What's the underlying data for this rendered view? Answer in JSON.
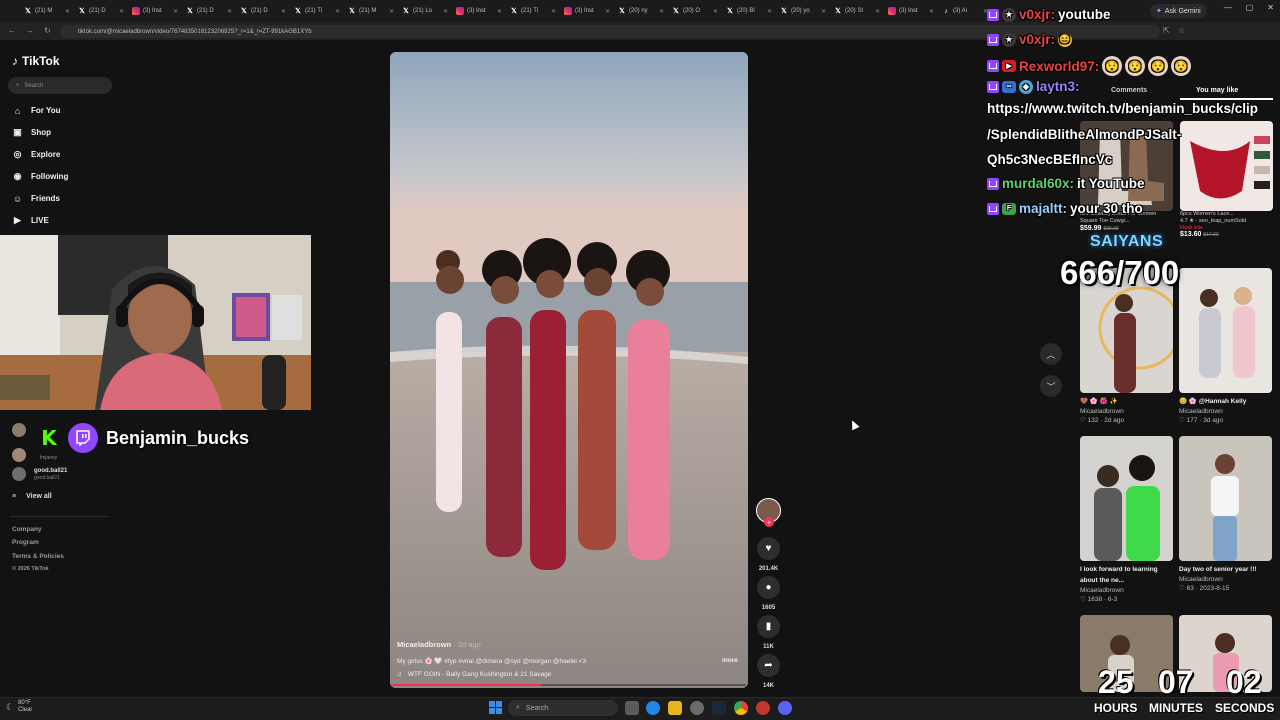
{
  "browser": {
    "tabs": [
      {
        "icon": "x-logo-icon",
        "label": "(21) M"
      },
      {
        "icon": "x-logo-icon",
        "label": "(21) D"
      },
      {
        "icon": "instagram-icon",
        "label": "(3) Inst"
      },
      {
        "icon": "x-logo-icon",
        "label": "(21) D"
      },
      {
        "icon": "x-logo-icon",
        "label": "(21) D"
      },
      {
        "icon": "x-logo-icon",
        "label": "(21) Ti"
      },
      {
        "icon": "x-logo-icon",
        "label": "(21) M"
      },
      {
        "icon": "x-logo-icon",
        "label": "(21) Lo"
      },
      {
        "icon": "instagram-icon",
        "label": "(3) Inst"
      },
      {
        "icon": "x-logo-icon",
        "label": "(21) Ti"
      },
      {
        "icon": "instagram-icon",
        "label": "(3) Inst"
      },
      {
        "icon": "x-logo-icon",
        "label": "(20) ny"
      },
      {
        "icon": "x-logo-icon",
        "label": "(20) O"
      },
      {
        "icon": "x-logo-icon",
        "label": "(20) Bi"
      },
      {
        "icon": "x-logo-icon",
        "label": "(20) yo"
      },
      {
        "icon": "x-logo-icon",
        "label": "(20) St"
      },
      {
        "icon": "instagram-icon",
        "label": "(3) Inst"
      },
      {
        "icon": "tiktok-icon",
        "label": "(3) Ai"
      }
    ],
    "gemini_label": "Ask Gemini",
    "url": "tiktok.com/@micaeladbrown/video/7674835016123206925?_r=1&_t=ZT-991kAGB1XYb"
  },
  "tiktok": {
    "logo_text": "TikTok",
    "search_placeholder": "Search",
    "nav": [
      {
        "icon": "home-icon",
        "label": "For You"
      },
      {
        "icon": "shop-bag-icon",
        "label": "Shop"
      },
      {
        "icon": "compass-icon",
        "label": "Explore"
      },
      {
        "icon": "following-icon",
        "label": "Following"
      },
      {
        "icon": "friends-icon",
        "label": "Friends"
      },
      {
        "icon": "live-icon",
        "label": "LIVE"
      }
    ],
    "following_accounts": [
      {
        "name": "",
        "handle": "lmjaney"
      },
      {
        "name": "good.ball21",
        "handle": "good.ball21"
      }
    ],
    "view_all": "View all",
    "footer": [
      "Company",
      "Program",
      "Terms & Policies",
      "© 2026 TikTok"
    ]
  },
  "stream": {
    "streamer_name": "Benjamin_bucks",
    "saiyans_label": "SAIYANS",
    "saiyans_count": "666/700",
    "timer": {
      "hours": "25",
      "minutes": "07",
      "seconds": "02",
      "hours_label": "HOURS",
      "minutes_label": "MINUTES",
      "seconds_label": "SECONDS"
    },
    "chat": [
      {
        "user": "v0xjr:",
        "user_color": "#e64545",
        "message": "youtube"
      },
      {
        "user": "v0xjr:",
        "user_color": "#e64545",
        "message": ""
      },
      {
        "user": "Rexworld97:",
        "user_color": "#e64545",
        "message": ""
      },
      {
        "user": "laytn3:",
        "user_color": "#9b82ff",
        "message": ""
      },
      {
        "user": "murdal60x:",
        "user_color": "#5fd36b",
        "message": "it YouTube"
      },
      {
        "user": "majaltt:",
        "user_color": "#9ad0ff",
        "message": "your 30 tho"
      }
    ],
    "chat_url_lines": [
      "https://www.twitch.tv/benjamin_bucks/clip",
      "/SplendidBlitheAlmondPJSalt-",
      "Qh5c3NecBEfIncVc"
    ]
  },
  "video": {
    "author": "Micaeladbrown",
    "age": "· 2d ago",
    "caption": "My girlss 🌸 🤍 #fyp #viral @dimera @syd @morgan @haelei <3",
    "more_label": "more",
    "music": "WTF GOIN - Bally Gang Kushington & 21 Savage",
    "progress": 0.42,
    "likes": "201.4K",
    "comments": "1605",
    "saves": "11K",
    "shares": "14K"
  },
  "right_panel": {
    "tabs": [
      "Comments",
      "You may like"
    ],
    "products": [
      {
        "title": "IUV Cowboy Boots For Women Square Toe Cowgi...",
        "price": "$59.99",
        "old_price": "$89.99",
        "flash": ""
      },
      {
        "title": "6pcs Women's Lace...",
        "rating": "4.7 ★ · seo_leap_numSold",
        "price": "$13.60",
        "old_price": "$17.00",
        "flash": "Flash sale"
      }
    ],
    "videos": [
      {
        "title": "🤎 🌸 🌺 ✨",
        "author": "Micaeladbrown",
        "meta": "♡ 132 · 2d ago"
      },
      {
        "title": "😊 🌸 @Hannah Kelly",
        "author": "Micaeladbrown",
        "meta": "♡ 177 · 3d ago"
      },
      {
        "title": "I look forward to learning about the ne...",
        "author": "Micaeladbrown",
        "meta": "♡ 1638 · 6-3"
      },
      {
        "title": "Day two of senior year !!!",
        "author": "Micaeladbrown",
        "meta": "♡ 63 · 2023-8-15"
      }
    ]
  },
  "taskbar": {
    "weather_temp": "80°F",
    "weather_desc": "Clear",
    "search_placeholder": "Search"
  }
}
